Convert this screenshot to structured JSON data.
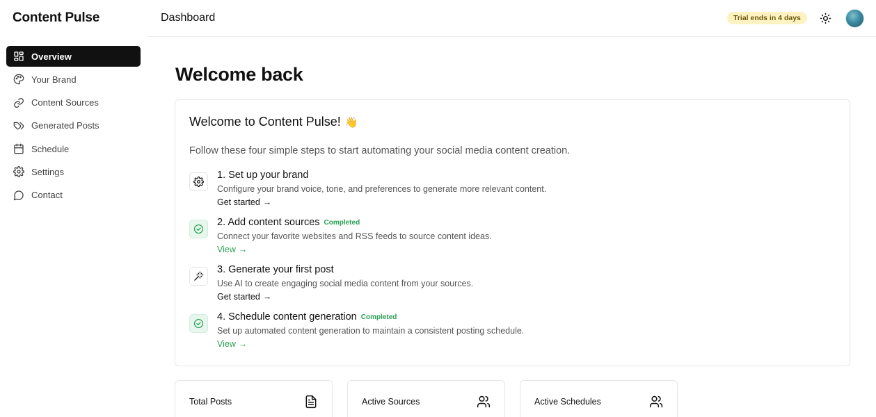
{
  "app": {
    "title": "Content Pulse"
  },
  "sidebar": {
    "items": [
      {
        "label": "Overview",
        "icon": "layout-grid-icon",
        "active": true
      },
      {
        "label": "Your Brand",
        "icon": "palette-icon",
        "active": false
      },
      {
        "label": "Content Sources",
        "icon": "link-icon",
        "active": false
      },
      {
        "label": "Generated Posts",
        "icon": "tag-icon",
        "active": false
      },
      {
        "label": "Schedule",
        "icon": "calendar-icon",
        "active": false
      },
      {
        "label": "Settings",
        "icon": "gear-icon",
        "active": false
      },
      {
        "label": "Contact",
        "icon": "message-circle-icon",
        "active": false
      }
    ]
  },
  "header": {
    "breadcrumb": "Dashboard",
    "trial_badge": "Trial ends in 4 days",
    "theme_icon": "sun-icon"
  },
  "main": {
    "title": "Welcome back",
    "welcome_card": {
      "title": "Welcome to Content Pulse!",
      "emoji": "👋",
      "description": "Follow these four simple steps to start automating your social media content creation.",
      "steps": [
        {
          "title": "1. Set up your brand",
          "badge": "",
          "description": "Configure your brand voice, tone, and preferences to generate more relevant content.",
          "link": "Get started",
          "icon": "gear-icon",
          "completed": false
        },
        {
          "title": "2. Add content sources",
          "badge": "Completed",
          "description": "Connect your favorite websites and RSS feeds to source content ideas.",
          "link": "View",
          "icon": "check-circle-icon",
          "completed": true
        },
        {
          "title": "3. Generate your first post",
          "badge": "",
          "description": "Use AI to create engaging social media content from your sources.",
          "link": "Get started",
          "icon": "magic-wand-icon",
          "completed": false
        },
        {
          "title": "4. Schedule content generation",
          "badge": "Completed",
          "description": "Set up automated content generation to maintain a consistent posting schedule.",
          "link": "View",
          "icon": "check-circle-icon",
          "completed": true
        }
      ],
      "arrow": "→"
    },
    "stats": [
      {
        "label": "Total Posts",
        "icon": "file-text-icon"
      },
      {
        "label": "Active Sources",
        "icon": "users-icon"
      },
      {
        "label": "Active Schedules",
        "icon": "users-icon"
      }
    ]
  },
  "colors": {
    "accent_active": "#111111",
    "completed_green": "#2aa055",
    "trial_badge_bg": "#fdf3c2"
  }
}
